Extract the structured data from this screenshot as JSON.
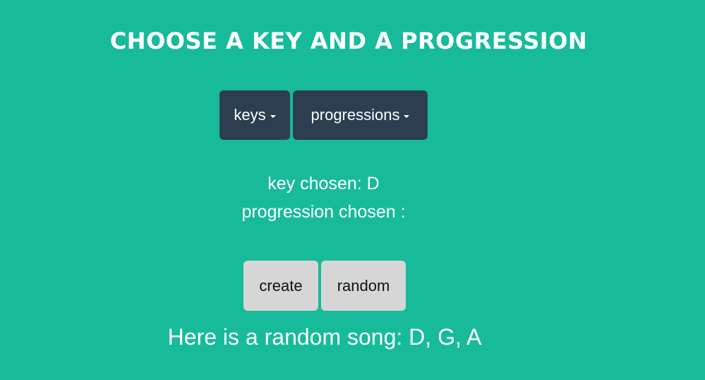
{
  "colors": {
    "background": "#17bb9a",
    "dropdown_bg": "#2c3e50",
    "button_bg": "#d6d6d6",
    "text": "#ffffff"
  },
  "header": {
    "title": "CHOOSE A KEY AND A PROGRESSION"
  },
  "dropdowns": {
    "keys_label": "keys",
    "progressions_label": "progressions"
  },
  "status": {
    "key_text": "key chosen: D",
    "progression_text": "progression chosen :"
  },
  "actions": {
    "create_label": "create",
    "random_label": "random"
  },
  "result": {
    "song_text": "Here is a random song: D, G, A"
  }
}
